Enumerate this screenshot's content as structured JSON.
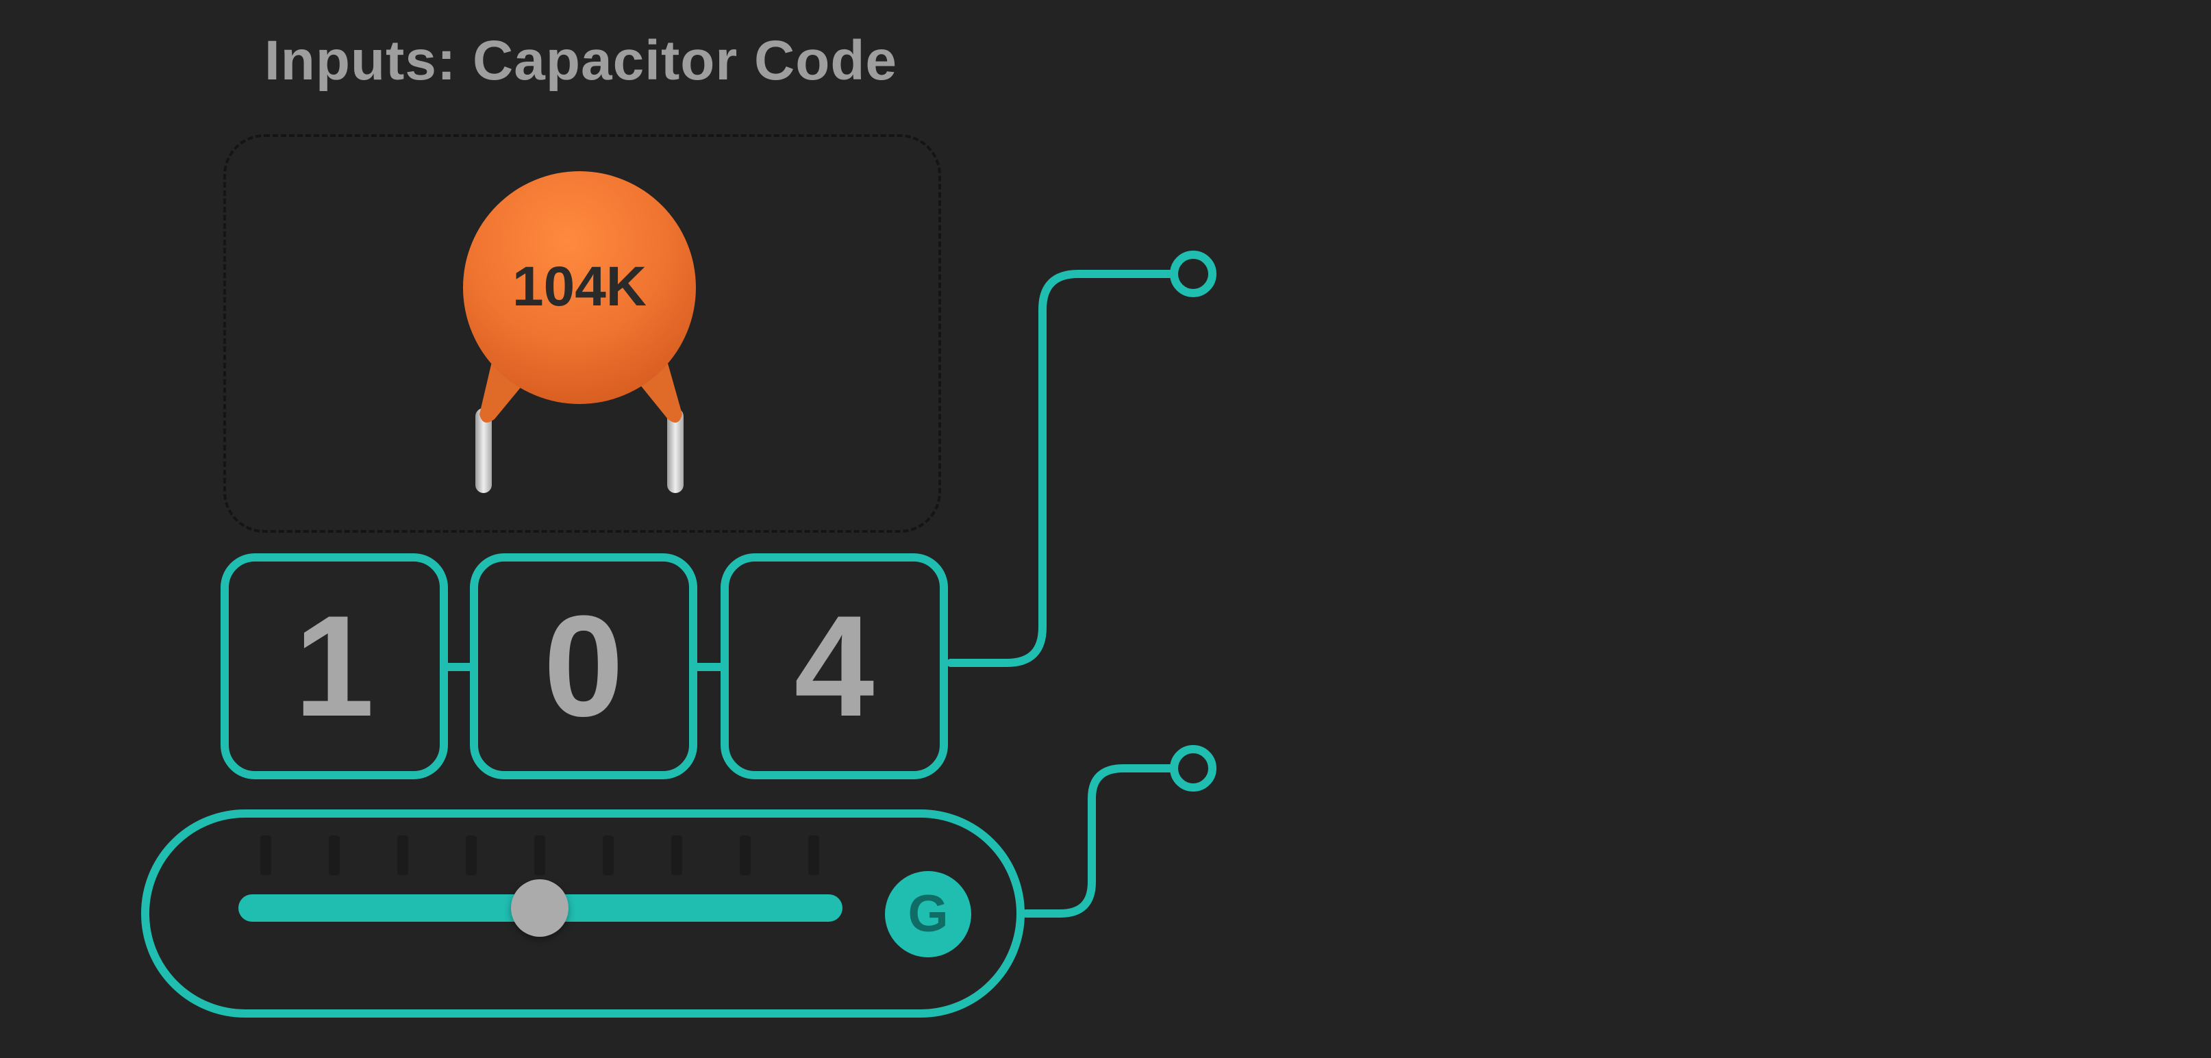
{
  "title": "Inputs: Capacitor Code",
  "capacitor": {
    "code_label": "104K",
    "body_color": "#f07a34",
    "lead_color": "#d0d0d0"
  },
  "digits": [
    {
      "value": "1"
    },
    {
      "value": "0"
    },
    {
      "value": "4"
    }
  ],
  "slider": {
    "value_fraction": 0.5,
    "button_label": "G"
  },
  "colors": {
    "accent": "#20bdb1",
    "background": "#232323",
    "text": "#a7a7a7"
  }
}
